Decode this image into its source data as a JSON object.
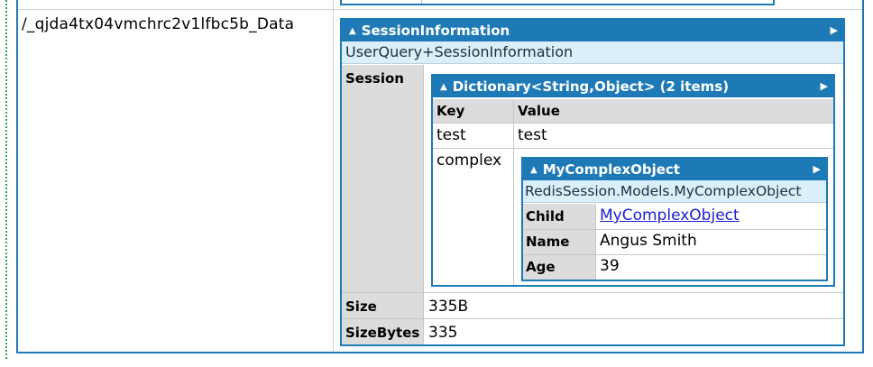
{
  "row_key": "/_qjda4tx04vmchrc2v1lfbc5b_Data",
  "session_info": {
    "header": "SessionInformation",
    "type_name": "UserQuery+SessionInformation",
    "labels": {
      "session": "Session",
      "size": "Size",
      "size_bytes": "SizeBytes"
    },
    "values": {
      "size": "335B",
      "size_bytes": "335"
    }
  },
  "dictionary": {
    "header": "Dictionary<String,Object> (2 items)",
    "columns": [
      "Key",
      "Value"
    ],
    "rows": [
      {
        "key": "test",
        "value": "test"
      },
      {
        "key": "complex",
        "value": ""
      }
    ]
  },
  "complex_object": {
    "header": "MyComplexObject",
    "type_name": "RedisSession.Models.MyComplexObject",
    "fields": [
      {
        "label": "Child",
        "value": "MyComplexObject",
        "is_link": true
      },
      {
        "label": "Name",
        "value": "Angus Smith",
        "is_link": false
      },
      {
        "label": "Age",
        "value": "39",
        "is_link": false
      }
    ]
  },
  "icons": {
    "collapse": "▲",
    "expand": "▶"
  },
  "colors": {
    "header_blue": "#1e7ab6",
    "type_row": "#dbeefb",
    "label_gray": "#dcdcdc",
    "link": "#1a20d6"
  }
}
